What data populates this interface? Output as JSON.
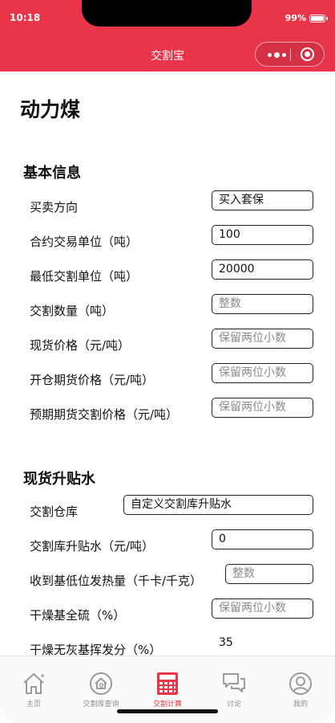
{
  "status_bar": {
    "time": "10:18",
    "battery": "99%"
  },
  "nav": {
    "title": "交割宝"
  },
  "page": {
    "title": "动力煤"
  },
  "sections": {
    "basic": {
      "title": "基本信息",
      "rows": [
        {
          "label": "买卖方向",
          "value": "买入套保",
          "placeholder": ""
        },
        {
          "label": "合约交易单位（吨）",
          "value": "100",
          "placeholder": ""
        },
        {
          "label": "最低交割单位（吨）",
          "value": "20000",
          "placeholder": ""
        },
        {
          "label": "交割数量（吨）",
          "value": "",
          "placeholder": "整数"
        },
        {
          "label": "现货价格（元/吨）",
          "value": "",
          "placeholder": "保留两位小数"
        },
        {
          "label": "开仓期货价格（元/吨）",
          "value": "",
          "placeholder": "保留两位小数"
        },
        {
          "label": "预期期货交割价格（元/吨）",
          "value": "",
          "placeholder": "保留两位小数"
        }
      ]
    },
    "spot": {
      "title": "现货升贴水",
      "rows": [
        {
          "label": "交割仓库",
          "value": "自定义交割库升贴水",
          "placeholder": ""
        },
        {
          "label": "交割库升贴水（元/吨）",
          "value": "0",
          "placeholder": ""
        },
        {
          "label": "收到基低位发热量（千卡/千克）",
          "value": "",
          "placeholder": "整数"
        },
        {
          "label": "干燥基全硫（%）",
          "value": "",
          "placeholder": "保留两位小数"
        },
        {
          "label": "干燥无灰基挥发分（%）",
          "value": "35",
          "placeholder": ""
        }
      ]
    }
  },
  "tabbar": {
    "items": [
      {
        "label": "主页",
        "icon": "home-icon",
        "active": false
      },
      {
        "label": "交割库查询",
        "icon": "warehouse-search-icon",
        "active": false
      },
      {
        "label": "交割计算",
        "icon": "calculator-icon",
        "active": true
      },
      {
        "label": "讨论",
        "icon": "chat-icon",
        "active": false
      },
      {
        "label": "我的",
        "icon": "user-icon",
        "active": false
      }
    ]
  },
  "colors": {
    "brand": "#e8354a",
    "inactive": "#8c8c8c"
  }
}
